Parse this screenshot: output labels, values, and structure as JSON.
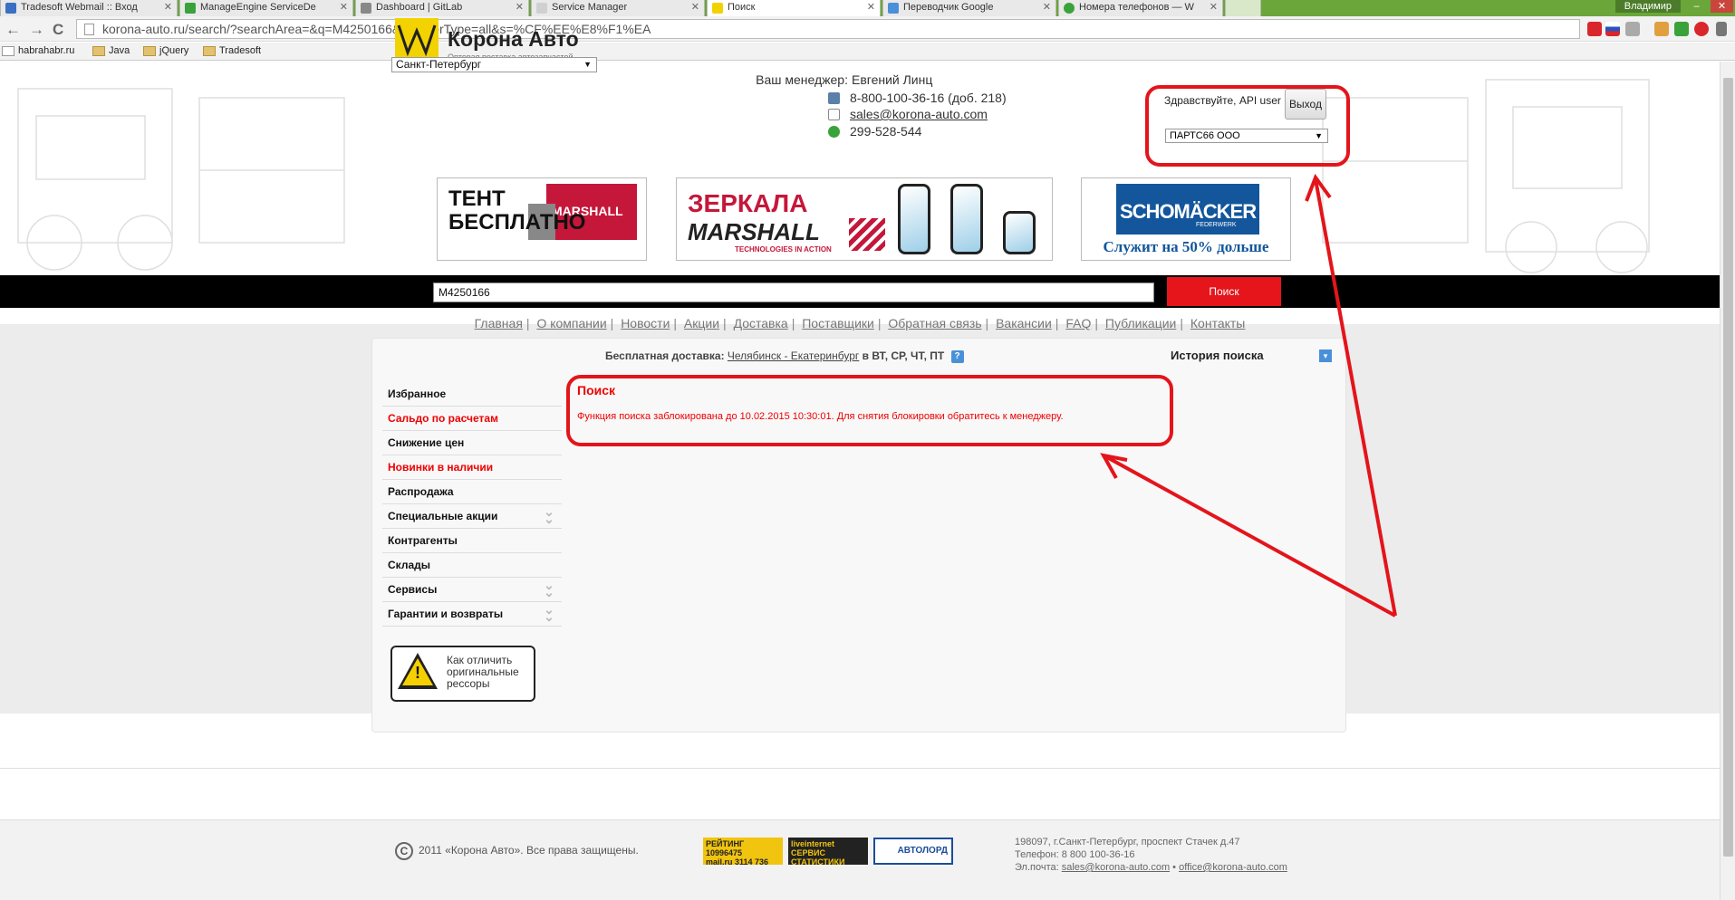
{
  "browser": {
    "tabs": [
      {
        "title": "Tradesoft Webmail :: Вход",
        "color": "#3a6fc4"
      },
      {
        "title": "ManageEngine ServiceDe",
        "color": "#3aa23a"
      },
      {
        "title": "Dashboard | GitLab",
        "color": "#888888"
      },
      {
        "title": "Service Manager",
        "color": "#d0d0d0"
      },
      {
        "title": "Поиск",
        "color": "#f2d200"
      },
      {
        "title": "Переводчик Google",
        "color": "#4a90d9"
      },
      {
        "title": "Номера телефонов — W",
        "color": "#3aa23a"
      }
    ],
    "user": "Владимир",
    "win_minimize": "–",
    "win_close": "✕",
    "url": "korona-auto.ru/search/?searchArea=&q=M4250166&numberType=all&s=%CF%EE%E8%F1%EA",
    "back": "←",
    "forward": "→",
    "reload": "C",
    "bookmarks": [
      "habrahabr.ru",
      "Java",
      "jQuery",
      "Tradesoft"
    ]
  },
  "header": {
    "logo_name": "Корона Авто",
    "logo_sub": "Оптовая поставка автозапчастей",
    "city": "Санкт-Петербург",
    "manager_label": "Ваш менеджер:",
    "manager_name": "Евгений Линц",
    "phone": "8-800-100-36-16 (доб. 218)",
    "email": "sales@korona-auto.com",
    "icq": "299-528-544",
    "greeting": "Здравствуйте, API user",
    "logout": "Выход",
    "company": "ПАРТС66 ООО"
  },
  "banners": {
    "b1_line1": "ТЕНТ",
    "b1_line2": "БЕСПЛАТНО",
    "b1_brand": "MARSHALL",
    "b2_line1": "ЗЕРКАЛА",
    "b2_line2": "MARSHALL",
    "b2_line3": "TECHNOLOGIES IN ACTION",
    "b3_logo": "SCHOMÄCKER",
    "b3_logo_sub": "FEDERWERK",
    "b3_slogan": "Служит на 50% дольше"
  },
  "search": {
    "value": "M4250166",
    "button": "Поиск"
  },
  "menu": [
    "Главная",
    "О компании",
    "Новости",
    "Акции",
    "Доставка",
    "Поставщики",
    "Обратная связь",
    "Вакансии",
    "FAQ",
    "Публикации",
    "Контакты"
  ],
  "delivery": {
    "label": "Бесплатная доставка:",
    "route": "Челябинск - Екатеринбург",
    "days": "в ВТ, СР, ЧТ, ПТ",
    "help": "?"
  },
  "history": {
    "label": "История поиска",
    "toggle": "▾"
  },
  "sidebar": [
    {
      "label": "Избранное",
      "accent": false,
      "expand": false
    },
    {
      "label": "Сальдо по расчетам",
      "accent": true,
      "expand": false
    },
    {
      "label": "Снижение цен",
      "accent": false,
      "expand": false
    },
    {
      "label": "Новинки в наличии",
      "accent": true,
      "expand": false
    },
    {
      "label": "Распродажа",
      "accent": false,
      "expand": false
    },
    {
      "label": "Специальные акции",
      "accent": false,
      "expand": true
    },
    {
      "label": "Контрагенты",
      "accent": false,
      "expand": false
    },
    {
      "label": "Склады",
      "accent": false,
      "expand": false
    },
    {
      "label": "Сервисы",
      "accent": false,
      "expand": true
    },
    {
      "label": "Гарантии и возвраты",
      "accent": false,
      "expand": true
    }
  ],
  "promo": {
    "text": "Как отличить оригинальные рессоры",
    "icon_glyph": "!"
  },
  "result": {
    "title": "Поиск",
    "message": "Функция поиска заблокирована до 10.02.2015 10:30:01. Для снятия блокировки обратитесь к менеджеру."
  },
  "footer": {
    "copyright_sign": "C",
    "copyright": "2011 «Корона Авто». Все права защищены.",
    "counter_mail_top": "РЕЙТИНГ 10996475",
    "counter_mail_bottom": "mail.ru 3114 736",
    "counter_li_top": "liveinternet",
    "counter_li_bottom": "СЕРВИС СТАТИСТИКИ",
    "counter_autolord": "АВТОЛОРД",
    "address": "198097, г.Санкт-Петербург, проспект Стачек д.47",
    "phone": "Телефон: 8 800 100-36-16",
    "email_label": "Эл.почта:",
    "email1": "sales@korona-auto.com",
    "email_sep": " • ",
    "email2": "office@korona-auto.com"
  },
  "colors": {
    "accent_red": "#e5151b",
    "annotation_red": "#e3151b",
    "chrome_green": "#6aa63a",
    "logo_yellow": "#f2d200"
  }
}
